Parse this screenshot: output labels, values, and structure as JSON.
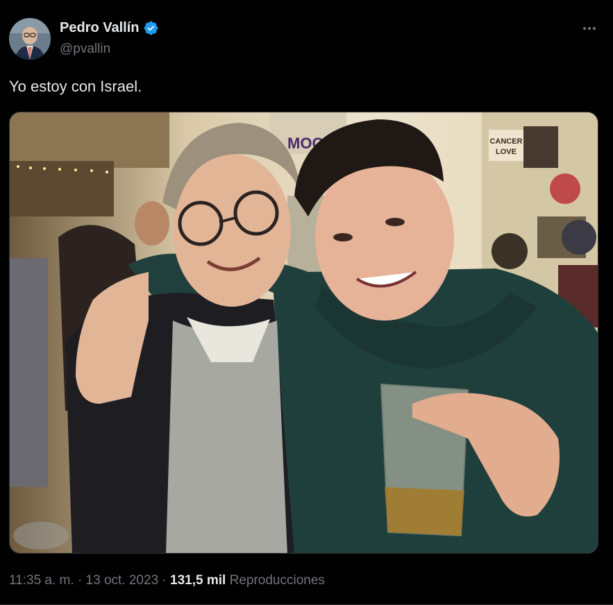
{
  "author": {
    "name": "Pedro Vallín",
    "handle": "@pvallin",
    "verified_icon": "verified-badge-icon",
    "verified_color": "#1d9bf0"
  },
  "tweet": {
    "text": "Yo estoy con Israel.",
    "more_icon": "more-horizontal-icon"
  },
  "meta": {
    "time": "11:35 a. m.",
    "sep1": "·",
    "date": "13 oct. 2023",
    "sep2": "·",
    "views_count": "131,5 mil",
    "views_label": "Reproducciones"
  },
  "media": {
    "poster_texts": [
      "CANCER",
      "LOVE",
      "MOO"
    ]
  },
  "colors": {
    "background": "#000000",
    "primary_text": "#e7e9ea",
    "secondary_text": "#71767b",
    "divider": "#2f3336"
  }
}
